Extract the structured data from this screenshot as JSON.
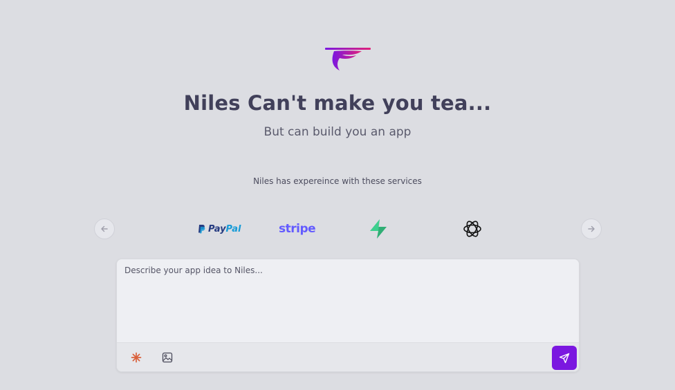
{
  "hero": {
    "title": "Niles Can't make you tea...",
    "subtitle": "But can build you an app"
  },
  "services": {
    "label": "Niles has expereince with these services",
    "items": [
      {
        "name": "paypal-logo",
        "text_primary": "Pay",
        "text_secondary": "Pal",
        "color_primary": "#253b80",
        "color_secondary": "#179bd7"
      },
      {
        "name": "stripe-logo",
        "text": "stripe",
        "color": "#635bff"
      },
      {
        "name": "supabase-logo",
        "icon": "bolt-icon",
        "color": "#3ecf8e"
      },
      {
        "name": "openai-logo",
        "icon": "openai-knot-icon",
        "color": "#111111"
      }
    ],
    "prev_icon": "arrow-left-icon",
    "next_icon": "arrow-right-icon"
  },
  "composer": {
    "placeholder": "Describe your app idea to Niles...",
    "value": "",
    "tools": [
      "sparkle-icon",
      "image-icon"
    ],
    "send_icon": "send-icon",
    "send_color": "#7b17e0"
  },
  "colors": {
    "background": "#dcdde2",
    "logo_gradient": [
      "#7b17e0",
      "#e0217a"
    ]
  }
}
